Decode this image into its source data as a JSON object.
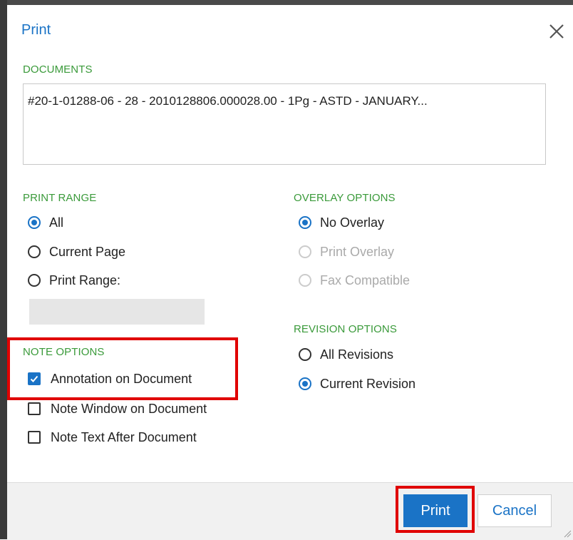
{
  "dialog": {
    "title": "Print"
  },
  "documents": {
    "label": "DOCUMENTS",
    "items": [
      "#20-1-01288-06 - 28 - 2010128806.000028.00 - 1Pg - ASTD - JANUARY..."
    ]
  },
  "print_range": {
    "label": "PRINT RANGE",
    "options": [
      {
        "label": "All",
        "checked": true
      },
      {
        "label": "Current Page",
        "checked": false
      },
      {
        "label": "Print Range:",
        "checked": false
      }
    ],
    "range_value": ""
  },
  "overlay_options": {
    "label": "OVERLAY OPTIONS",
    "options": [
      {
        "label": "No Overlay",
        "checked": true,
        "disabled": false
      },
      {
        "label": "Print Overlay",
        "checked": false,
        "disabled": true
      },
      {
        "label": "Fax Compatible",
        "checked": false,
        "disabled": true
      }
    ]
  },
  "revision_options": {
    "label": "REVISION OPTIONS",
    "options": [
      {
        "label": "All Revisions",
        "checked": false
      },
      {
        "label": "Current Revision",
        "checked": true
      }
    ]
  },
  "note_options": {
    "label": "NOTE OPTIONS",
    "options": [
      {
        "label": "Annotation on Document",
        "checked": true
      },
      {
        "label": "Note Window on Document",
        "checked": false
      },
      {
        "label": "Note Text After Document",
        "checked": false
      }
    ]
  },
  "footer": {
    "print_label": "Print",
    "cancel_label": "Cancel"
  },
  "colors": {
    "accent": "#1a73c6",
    "section_label": "#3a9a3a",
    "highlight": "#e00000"
  }
}
